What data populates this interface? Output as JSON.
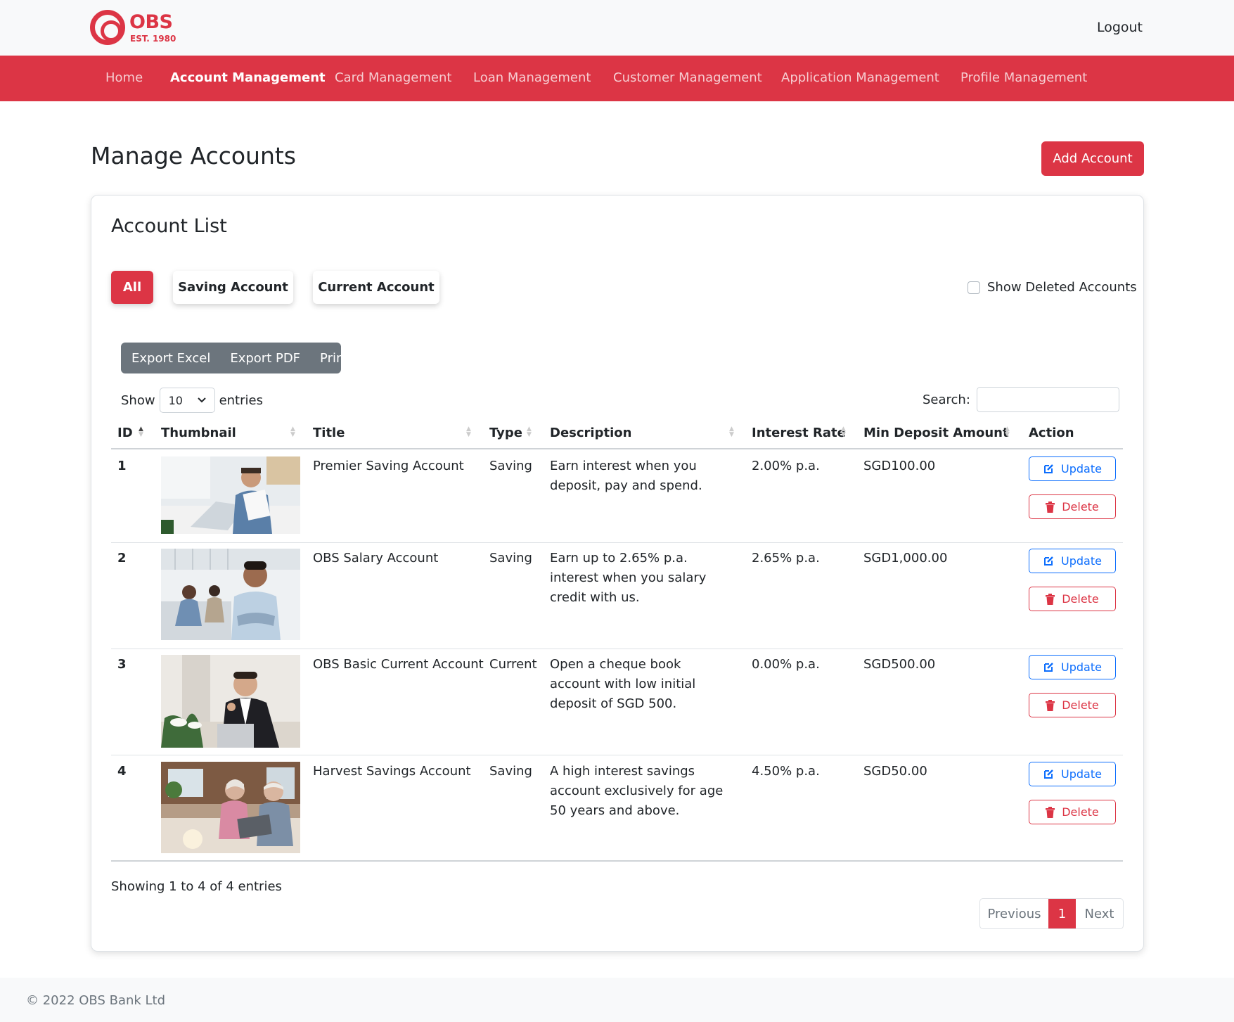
{
  "brand": {
    "name": "OBS",
    "est": "EST. 1980",
    "color": "#dc3545"
  },
  "header": {
    "logout_label": "Logout"
  },
  "nav": {
    "items": [
      {
        "label": "Home",
        "active": false
      },
      {
        "label": "Account Management",
        "active": true
      },
      {
        "label": "Card Management",
        "active": false
      },
      {
        "label": "Loan Management",
        "active": false
      },
      {
        "label": "Customer Management",
        "active": false
      },
      {
        "label": "Application Management",
        "active": false
      },
      {
        "label": "Profile Management",
        "active": false
      }
    ]
  },
  "page": {
    "title": "Manage Accounts",
    "add_button": "Add Account"
  },
  "card": {
    "title": "Account List",
    "filters": [
      "All",
      "Saving Account",
      "Current Account"
    ],
    "active_filter": "All",
    "show_deleted_label": "Show Deleted Accounts",
    "show_deleted_checked": false,
    "export_buttons": [
      "Export Excel",
      "Export PDF",
      "Print"
    ],
    "length_prefix": "Show",
    "length_value": "10",
    "length_suffix": "entries",
    "search_label": "Search:",
    "search_value": ""
  },
  "table": {
    "columns": [
      "ID",
      "Thumbnail",
      "Title",
      "Type",
      "Description",
      "Interest Rate",
      "Min Deposit Amount",
      "Action"
    ],
    "update_label": "Update",
    "delete_label": "Delete",
    "rows": [
      {
        "id": "1",
        "title": "Premier Saving Account",
        "type": "Saving",
        "description": "Earn interest when you deposit, pay and spend.",
        "interest": "2.00% p.a.",
        "min_deposit": "SGD100.00",
        "thumbnail": "man with laptop and papers"
      },
      {
        "id": "2",
        "title": "OBS Salary Account",
        "type": "Saving",
        "description": "Earn up to 2.65% p.a. interest when you salary credit with us.",
        "interest": "2.65% p.a.",
        "min_deposit": "SGD1,000.00",
        "thumbnail": "smiling man in office"
      },
      {
        "id": "3",
        "title": "OBS Basic Current Account",
        "type": "Current",
        "description": "Open a cheque book account with low initial deposit of SGD 500.",
        "interest": "0.00% p.a.",
        "min_deposit": "SGD500.00",
        "thumbnail": "businessman thumbs up"
      },
      {
        "id": "4",
        "title": "Harvest Savings Account",
        "type": "Saving",
        "description": "A high interest savings account exclusively for age 50 years and above.",
        "interest": "4.50% p.a.",
        "min_deposit": "SGD50.00",
        "thumbnail": "senior couple with laptop"
      }
    ]
  },
  "pagination": {
    "info": "Showing 1 to 4 of 4 entries",
    "previous": "Previous",
    "current": "1",
    "next": "Next"
  },
  "footer": {
    "copyright": "© 2022 OBS Bank Ltd"
  }
}
